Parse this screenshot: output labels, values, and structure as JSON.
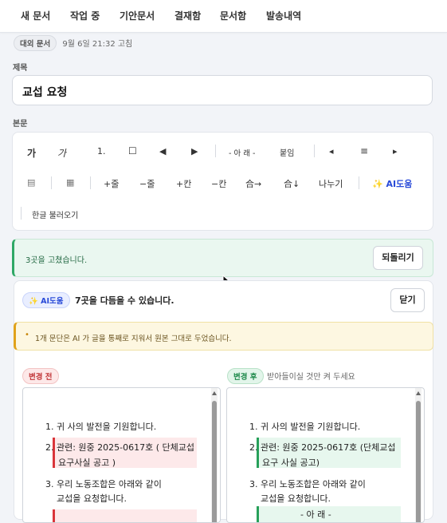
{
  "nav": {
    "items": [
      "새 문서",
      "작업 중",
      "기안문서",
      "결재함",
      "문서함",
      "발송내역"
    ]
  },
  "meta": {
    "doc_type_chip": "대외 문서",
    "modified": "9월 6일 21:32 고침"
  },
  "title_field": {
    "label": "제목",
    "value": "교섭 요청"
  },
  "body_label": "본문",
  "toolbar": {
    "row1": {
      "bold": "가",
      "italic": "가",
      "numbered": "1.",
      "checkbox": "☐",
      "prev": "◀",
      "next": "▶",
      "below_marker": "- 아 래 -",
      "attach": "붙임",
      "align_left": "◂",
      "align_center": "≡",
      "align_right": "▸"
    },
    "row2": {
      "table_icon": "▤",
      "grid_icon": "▦",
      "add_row": "+줄",
      "del_row": "−줄",
      "add_col": "+칸",
      "del_col": "−칸",
      "merge_right": "合→",
      "merge_down": "合↓",
      "split": "나누기",
      "ai_help": "AI도움"
    },
    "row3": {
      "hangul_import": "한글 불러오기"
    }
  },
  "success_banner": {
    "message": "3곳을 고쳤습니다.",
    "undo_label": "되돌리기"
  },
  "ai_panel": {
    "chip": "AI도움",
    "heading": "7곳을 다듬을 수 있습니다.",
    "close_label": "닫기",
    "warning": "1개 문단은 AI 가 글을 통째로 지워서 원본 그대로 두었습니다.",
    "before_chip": "변경 전",
    "after_chip": "변경 후",
    "after_hint": "받아들이실 것만 켜 두세요",
    "before_lines": {
      "l1": "1. 귀 사의 발전을 기원합니다.",
      "l2a": "2. 관련: 원중 2025-0617호 ( 단체교섭",
      "l2b": "요구사실 공고 )",
      "l3a": "3. 우리 노동조합은 아래와 같이",
      "l3b": "교섭을 요청합니다."
    },
    "after_lines": {
      "l1": "1. 귀 사의 발전을 기원합니다.",
      "l2a": "2. 관련: 원중 2025-0617호 (단체교섭",
      "l2b": "요구 사실 공고)",
      "l3a": "3. 우리 노동조합은 아래와 같이",
      "l3b": "교섭을 요청합니다.",
      "l4": "- 아 래 -"
    }
  },
  "colors": {
    "accent": "#2a4bd8",
    "success": "#2fa866",
    "warning": "#e0a21a",
    "removed": "#d9353a",
    "added": "#27a05a"
  }
}
